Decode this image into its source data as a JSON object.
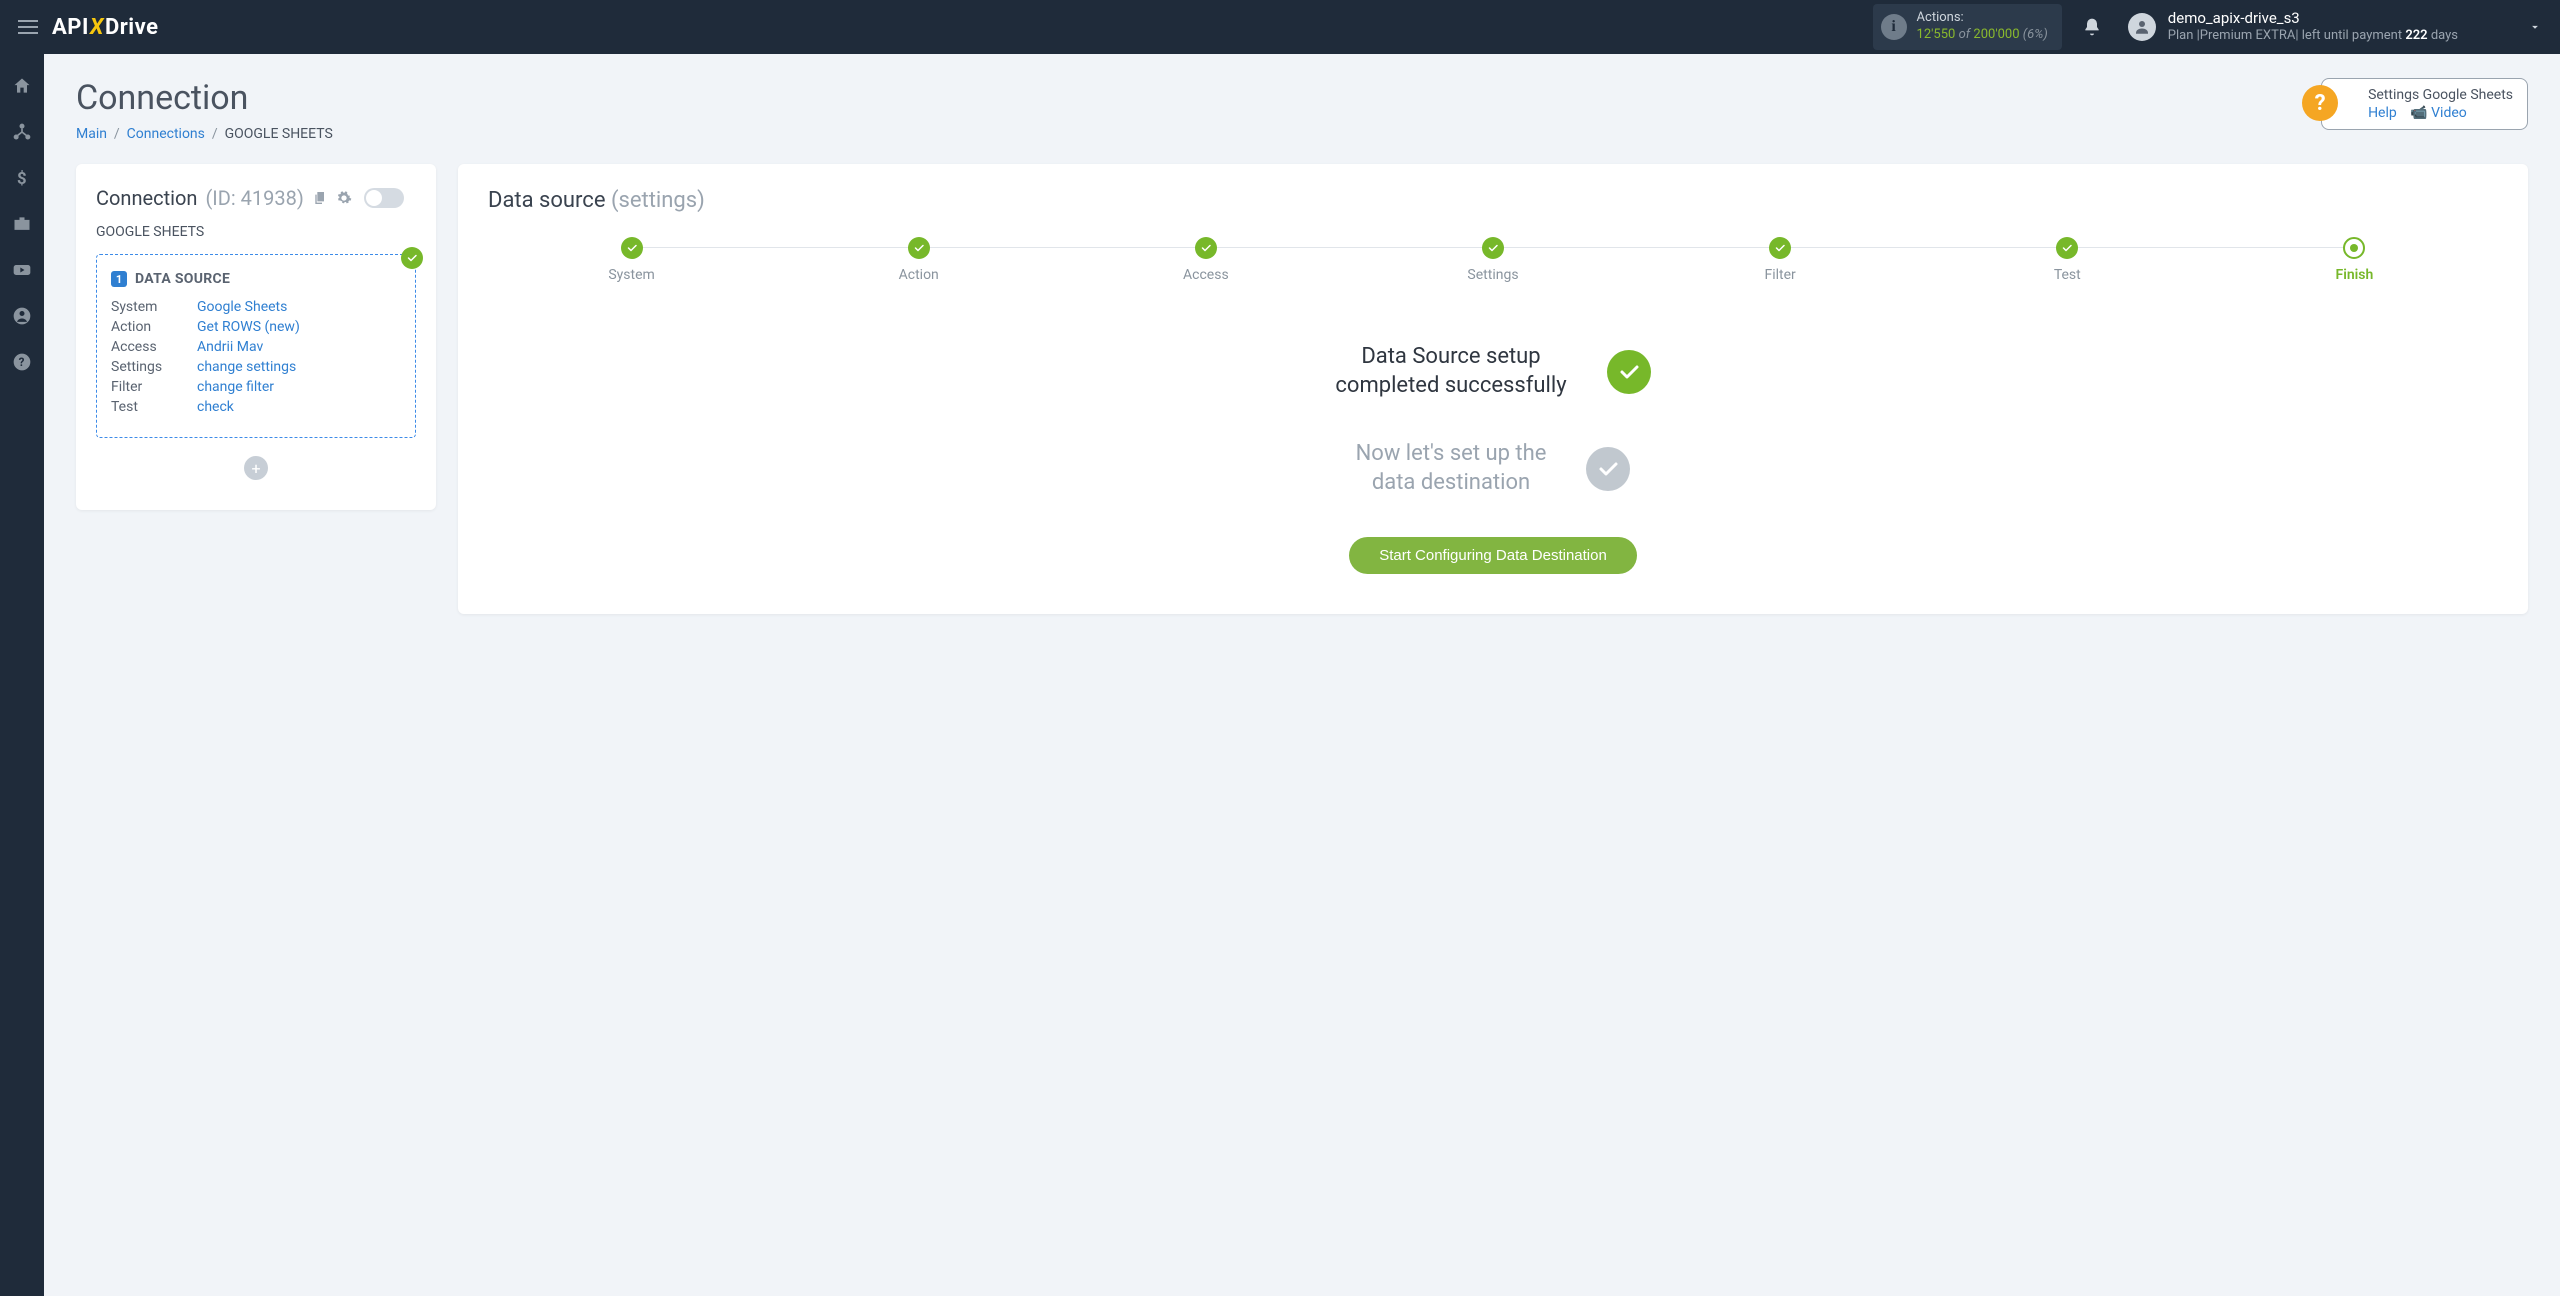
{
  "topbar": {
    "actions_label": "Actions:",
    "actions_used": "12'550",
    "actions_of": "of",
    "actions_total": "200'000",
    "actions_pct": "(6%)",
    "user_name": "demo_apix-drive_s3",
    "plan_prefix": "Plan |",
    "plan_name": "Premium EXTRA",
    "plan_suffix": "| left until payment",
    "plan_days": "222",
    "plan_days_word": "days"
  },
  "page": {
    "title": "Connection",
    "breadcrumb": {
      "main": "Main",
      "connections": "Connections",
      "current": "GOOGLE SHEETS"
    },
    "help": {
      "title": "Settings Google Sheets",
      "help": "Help",
      "video": "Video"
    }
  },
  "left": {
    "title": "Connection",
    "id": "(ID: 41938)",
    "sub": "GOOGLE SHEETS",
    "ds_label": "DATA SOURCE",
    "rows": {
      "system_k": "System",
      "system_v": "Google Sheets",
      "action_k": "Action",
      "action_v": "Get ROWS (new)",
      "access_k": "Access",
      "access_v": "Andrii Mav",
      "settings_k": "Settings",
      "settings_v": "change settings",
      "filter_k": "Filter",
      "filter_v": "change filter",
      "test_k": "Test",
      "test_v": "check"
    }
  },
  "right": {
    "title": "Data source",
    "title_muted": "(settings)",
    "steps": [
      "System",
      "Action",
      "Access",
      "Settings",
      "Filter",
      "Test",
      "Finish"
    ],
    "msg1_l1": "Data Source setup",
    "msg1_l2": "completed successfully",
    "msg2_l1": "Now let's set up the",
    "msg2_l2": "data destination",
    "cta": "Start Configuring Data Destination"
  }
}
